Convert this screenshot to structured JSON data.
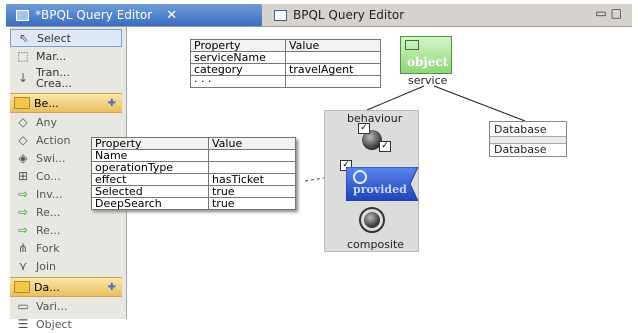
{
  "tabs": [
    {
      "label": "*BPQL Query Editor",
      "active": true
    },
    {
      "label": "BPQL Query Editor",
      "active": false
    }
  ],
  "palette": {
    "tools": [
      {
        "label": "Select",
        "icon": "arrow-cursor-icon"
      },
      {
        "label": "Mar...",
        "icon": "marquee-icon"
      },
      {
        "label": "Tran... Crea...",
        "icon": "transition-arrow-icon"
      }
    ],
    "drawer_behaviour": "Be...",
    "behaviour_items": [
      {
        "label": "Any",
        "icon": "any-icon"
      },
      {
        "label": "Action",
        "icon": "action-icon"
      },
      {
        "label": "Swi...",
        "icon": "switch-icon"
      },
      {
        "label": "Co...",
        "icon": "composite-icon"
      },
      {
        "label": "Inv...",
        "icon": "invoke-icon"
      },
      {
        "label": "Re...",
        "icon": "receive-icon"
      },
      {
        "label": "Re...",
        "icon": "reply-icon"
      },
      {
        "label": "Fork",
        "icon": "fork-icon"
      },
      {
        "label": "Join",
        "icon": "join-icon"
      }
    ],
    "drawer_data": "Da...",
    "data_items": [
      {
        "label": "Vari...",
        "icon": "variable-icon"
      },
      {
        "label": "Object",
        "icon": "object-icon"
      }
    ]
  },
  "service_props": {
    "headers": [
      "Property",
      "Value"
    ],
    "rows": [
      [
        "serviceName",
        ""
      ],
      [
        "category",
        "travelAgent"
      ],
      [
        "· · ·",
        ""
      ]
    ]
  },
  "node_props": {
    "headers": [
      "Property",
      "Value"
    ],
    "rows": [
      [
        "Name",
        ""
      ],
      [
        "operationType",
        ""
      ],
      [
        "effect",
        "hasTicket"
      ],
      [
        "Selected",
        "true"
      ],
      [
        "DeepSearch",
        "true"
      ]
    ]
  },
  "diagram": {
    "object_label": "object",
    "service_label": "service",
    "behaviour_label": "behaviour",
    "composite_label": "composite",
    "provided_label": "provided",
    "database_label_1": "Database",
    "database_label_2": "Database",
    "check_mark": "✓"
  },
  "colors": {
    "active_tab": "#3a6ec0",
    "object_green": "#8fd57a",
    "provided_blue": "#2f5fd0",
    "edge_red": "#cc1a1a"
  }
}
